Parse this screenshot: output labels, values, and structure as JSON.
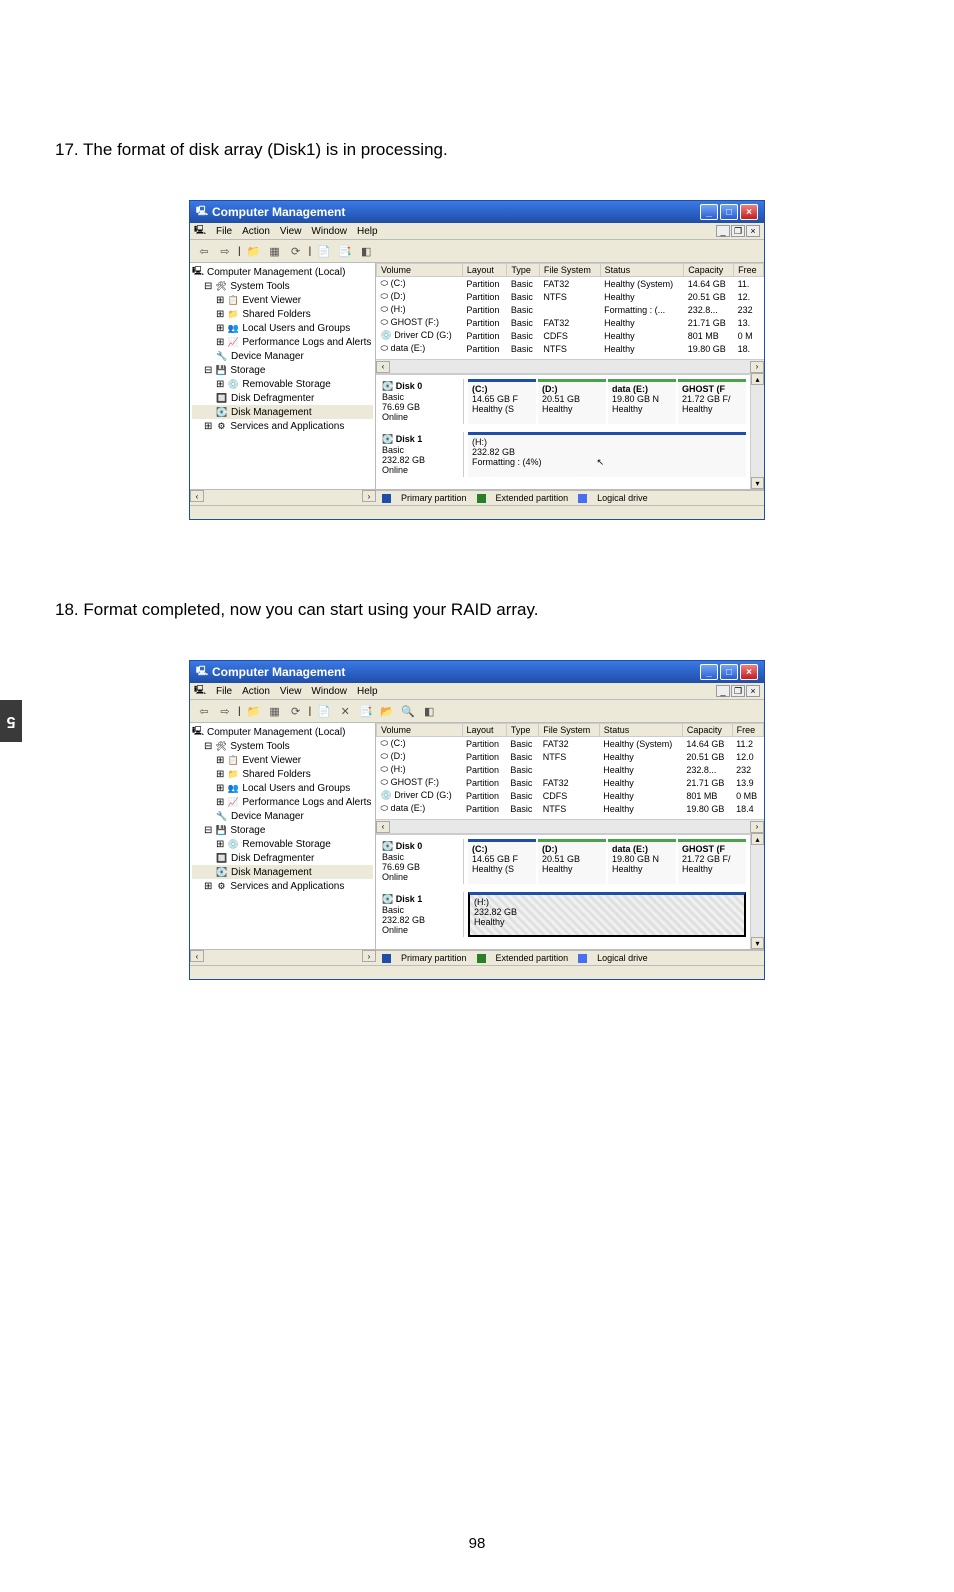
{
  "page_number": "98",
  "side_tab": "5",
  "step17_text": "17. The format of disk array (Disk1) is in processing.",
  "step18_text": "18. Format completed, now you can start using your RAID array.",
  "window_title": "Computer Management",
  "menu": {
    "file": "File",
    "action": "Action",
    "view": "View",
    "window": "Window",
    "help": "Help"
  },
  "tree": {
    "root": "Computer Management (Local)",
    "systools": "System Tools",
    "eventviewer": "Event Viewer",
    "sharedfolders": "Shared Folders",
    "localusers": "Local Users and Groups",
    "perflogs": "Performance Logs and Alerts",
    "devmgr": "Device Manager",
    "storage": "Storage",
    "removable": "Removable Storage",
    "defrag": "Disk Defragmenter",
    "diskmgmt": "Disk Management",
    "services": "Services and Applications"
  },
  "columns": {
    "volume": "Volume",
    "layout": "Layout",
    "type": "Type",
    "fs": "File System",
    "status": "Status",
    "capacity": "Capacity",
    "free": "Free"
  },
  "volumes1": [
    {
      "vol": "(C:)",
      "layout": "Partition",
      "type": "Basic",
      "fs": "FAT32",
      "status": "Healthy (System)",
      "cap": "14.64 GB",
      "free": "11."
    },
    {
      "vol": "(D:)",
      "layout": "Partition",
      "type": "Basic",
      "fs": "NTFS",
      "status": "Healthy",
      "cap": "20.51 GB",
      "free": "12."
    },
    {
      "vol": "(H:)",
      "layout": "Partition",
      "type": "Basic",
      "fs": "",
      "status": "Formatting : (...",
      "cap": "232.8...",
      "free": "232"
    },
    {
      "vol": "GHOST (F:)",
      "layout": "Partition",
      "type": "Basic",
      "fs": "FAT32",
      "status": "Healthy",
      "cap": "21.71 GB",
      "free": "13."
    },
    {
      "vol": "Driver CD (G:)",
      "layout": "Partition",
      "type": "Basic",
      "fs": "CDFS",
      "status": "Healthy",
      "cap": "801 MB",
      "free": "0 M"
    },
    {
      "vol": "data (E:)",
      "layout": "Partition",
      "type": "Basic",
      "fs": "NTFS",
      "status": "Healthy",
      "cap": "19.80 GB",
      "free": "18."
    }
  ],
  "volumes2": [
    {
      "vol": "(C:)",
      "layout": "Partition",
      "type": "Basic",
      "fs": "FAT32",
      "status": "Healthy (System)",
      "cap": "14.64 GB",
      "free": "11.2"
    },
    {
      "vol": "(D:)",
      "layout": "Partition",
      "type": "Basic",
      "fs": "NTFS",
      "status": "Healthy",
      "cap": "20.51 GB",
      "free": "12.0"
    },
    {
      "vol": "(H:)",
      "layout": "Partition",
      "type": "Basic",
      "fs": "",
      "status": "Healthy",
      "cap": "232.8...",
      "free": "232"
    },
    {
      "vol": "GHOST (F:)",
      "layout": "Partition",
      "type": "Basic",
      "fs": "FAT32",
      "status": "Healthy",
      "cap": "21.71 GB",
      "free": "13.9"
    },
    {
      "vol": "Driver CD (G:)",
      "layout": "Partition",
      "type": "Basic",
      "fs": "CDFS",
      "status": "Healthy",
      "cap": "801 MB",
      "free": "0 MB"
    },
    {
      "vol": "data (E:)",
      "layout": "Partition",
      "type": "Basic",
      "fs": "NTFS",
      "status": "Healthy",
      "cap": "19.80 GB",
      "free": "18.4"
    }
  ],
  "disk0": {
    "name": "Disk 0",
    "basic": "Basic",
    "size": "76.69 GB",
    "state": "Online",
    "parts": [
      {
        "name": "(C:)",
        "size": "14.65 GB F",
        "status": "Healthy (S"
      },
      {
        "name": "(D:)",
        "size": "20.51 GB",
        "status": "Healthy"
      },
      {
        "name": "data (E:)",
        "size": "19.80 GB N",
        "status": "Healthy"
      },
      {
        "name": "GHOST (F",
        "size": "21.72 GB F/",
        "status": "Healthy"
      }
    ]
  },
  "disk1_a": {
    "name": "Disk 1",
    "basic": "Basic",
    "size": "232.82 GB",
    "state": "Online",
    "part": {
      "name": "(H:)",
      "size": "232.82 GB",
      "status": "Formatting : (4%)"
    }
  },
  "disk1_b": {
    "name": "Disk 1",
    "basic": "Basic",
    "size": "232.82 GB",
    "state": "Online",
    "part": {
      "name": "(H:)",
      "size": "232.82 GB",
      "status": "Healthy"
    }
  },
  "legend": {
    "primary": "Primary partition",
    "extended": "Extended partition",
    "logical": "Logical drive"
  }
}
